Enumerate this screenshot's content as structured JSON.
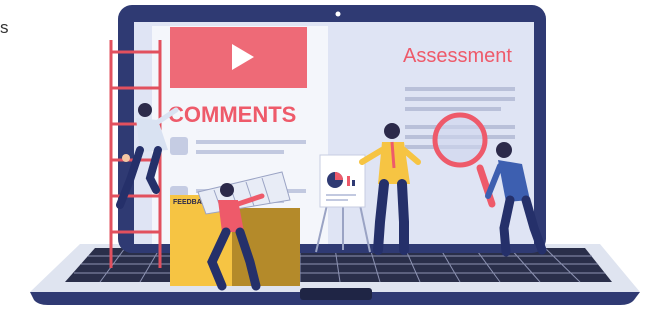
{
  "corner_text": "s",
  "screen": {
    "video_label": "",
    "comments_label": "COMMENTS",
    "assessment_label": "Assessment"
  },
  "folder": {
    "label": "FEEDBACK"
  },
  "colors": {
    "laptop_frame": "#2f3a73",
    "screen_bg": "#dfe4f4",
    "accent_red": "#ee5a6a",
    "folder_yellow": "#f6c443",
    "folder_brown": "#b48a2a",
    "suit_navy": "#25306a",
    "ladder_red": "#e2505e",
    "keyboard_dark": "#2a2f4a"
  },
  "icons": {
    "play": "play-icon",
    "magnifier": "magnifying-glass-icon",
    "pie": "pie-chart-icon"
  }
}
